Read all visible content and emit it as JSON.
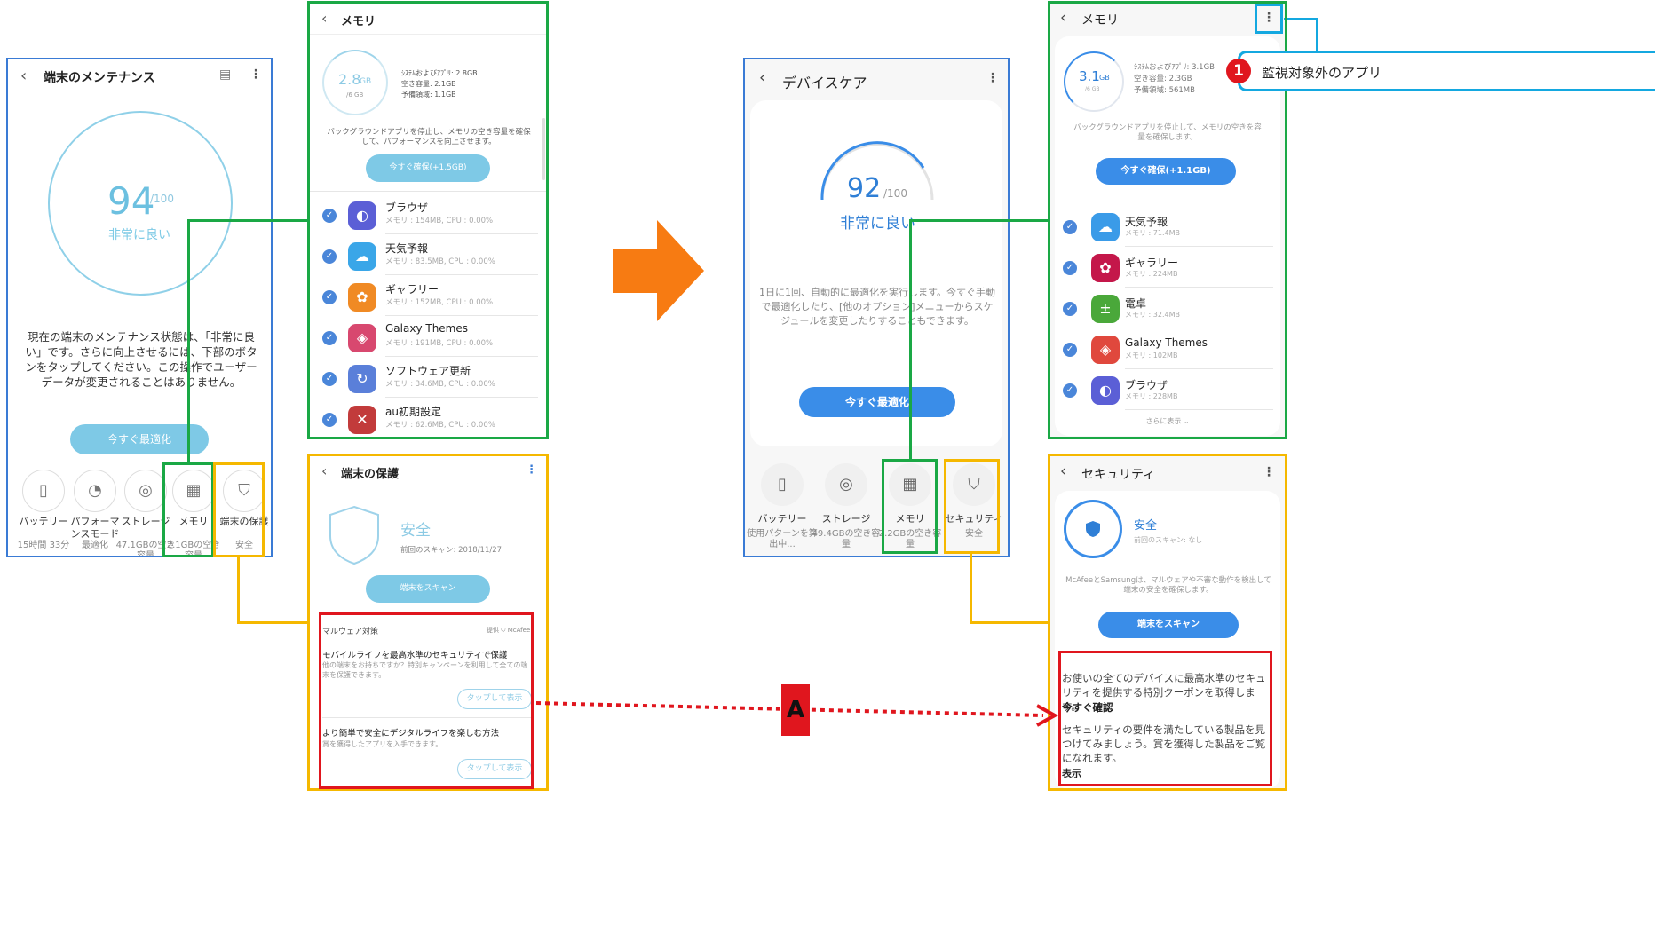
{
  "panel1": {
    "title": "端末のメンテナンス",
    "score": "94",
    "score_max": "/100",
    "status": "非常に良い",
    "desc": "現在の端末のメンテナンス状態は、「非常に良い」です。さらに向上させるには、下部のボタンをタップしてください。この操作でユーザーデータが変更されることはありません。",
    "button": "今すぐ最適化",
    "tiles": [
      {
        "label": "バッテリー",
        "sub": "15時間 33分",
        "icon": "battery-icon"
      },
      {
        "label": "パフォーマンスモード",
        "sub": "最適化",
        "icon": "speedometer-icon"
      },
      {
        "label": "ストレージ",
        "sub": "47.1GBの空き容量",
        "icon": "storage-icon"
      },
      {
        "label": "メモリ",
        "sub": "2.1GBの空き容量",
        "icon": "memory-chip-icon"
      },
      {
        "label": "端末の保護",
        "sub": "安全",
        "icon": "shield-icon"
      }
    ]
  },
  "panel2": {
    "title": "メモリ",
    "gauge_value": "2.8",
    "gauge_unit": "GB",
    "gauge_total": "/6 GB",
    "stat1": "ｼｽﾃﾑおよびｱﾌﾟﾘ: 2.8GB",
    "stat2": "空き容量: 2.1GB",
    "stat3": "予備領域: 1.1GB",
    "desc": "バックグラウンドアプリを停止し、メモリの空き容量を確保して、パフォーマンスを向上させます。",
    "button": "今すぐ確保(+1.5GB)",
    "apps": [
      {
        "name": "ブラウザ",
        "sub": "メモリ : 154MB, CPU : 0.00%"
      },
      {
        "name": "天気予報",
        "sub": "メモリ : 83.5MB, CPU : 0.00%"
      },
      {
        "name": "ギャラリー",
        "sub": "メモリ : 152MB, CPU : 0.00%"
      },
      {
        "name": "Galaxy Themes",
        "sub": "メモリ : 191MB, CPU : 0.00%"
      },
      {
        "name": "ソフトウェア更新",
        "sub": "メモリ : 34.6MB, CPU : 0.00%"
      },
      {
        "name": "au初期設定",
        "sub": "メモリ : 62.6MB, CPU : 0.00%"
      }
    ]
  },
  "panel3": {
    "title": "端末の保護",
    "status": "安全",
    "last_scan": "前回のスキャン: 2018/11/27",
    "button": "端末をスキャン",
    "section": "マルウェア対策",
    "provider": "提供 ⛉ McAfee",
    "card1_title": "モバイルライフを最高水準のセキュリティで保護",
    "card1_text": "他の端末をお持ちですか？特別キャンペーンを利用して全ての端末を保護できます。",
    "card1_button": "タップして表示",
    "card2_title": "より簡単で安全にデジタルライフを楽しむ方法",
    "card2_text": "賞を獲得したアプリを入手できます。",
    "card2_button": "タップして表示"
  },
  "panel4": {
    "title": "デバイスケア",
    "score": "92",
    "score_max": "/100",
    "status": "非常に良い",
    "desc": "1日に1回、自動的に最適化を実行します。今すぐ手動で最適化したり、[他のオプション]メニューからスケジュールを変更したりすることもできます。",
    "button": "今すぐ最適化",
    "tiles": [
      {
        "label": "バッテリー",
        "sub": "使用パターンを算出中...",
        "icon": "battery-icon"
      },
      {
        "label": "ストレージ",
        "sub": "49.4GBの空き容量",
        "icon": "storage-icon"
      },
      {
        "label": "メモリ",
        "sub": "2.2GBの空き容量",
        "icon": "memory-chip-icon"
      },
      {
        "label": "セキュリティ",
        "sub": "安全",
        "icon": "shield-icon"
      }
    ]
  },
  "panel5": {
    "title": "メモリ",
    "gauge_value": "3.1",
    "gauge_unit": "GB",
    "gauge_total": "/6 GB",
    "stat1": "ｼｽﾃﾑおよびｱﾌﾟﾘ: 3.1GB",
    "stat2": "空き容量: 2.3GB",
    "stat3": "予備領域: 561MB",
    "desc": "バックグラウンドアプリを停止して、メモリの空きを容量を確保します。",
    "button": "今すぐ確保(+1.1GB)",
    "apps": [
      {
        "name": "天気予報",
        "sub": "メモリ : 71.4MB"
      },
      {
        "name": "ギャラリー",
        "sub": "メモリ : 224MB"
      },
      {
        "name": "電卓",
        "sub": "メモリ : 32.4MB"
      },
      {
        "name": "Galaxy Themes",
        "sub": "メモリ : 102MB"
      },
      {
        "name": "ブラウザ",
        "sub": "メモリ : 228MB"
      }
    ],
    "more": "さらに表示 ⌄"
  },
  "panel6": {
    "title": "セキュリティ",
    "status": "安全",
    "last_scan": "前回のスキャン: なし",
    "desc": "McAfeeとSamsungは、マルウェアや不審な動作を検出して端末の安全を確保します。",
    "button": "端末をスキャン",
    "card1_text": "お使いの全てのデバイスに最高水準のセキュリティを提供する特別クーポンを取得します。",
    "card1_link": "今すぐ確認",
    "card2_text": "セキュリティの要件を満たしている製品を見つけてみましょう。賞を獲得した製品をご覧になれます。",
    "card2_link": "表示"
  },
  "callout1": {
    "number": "1",
    "label": "監視対象外のアプリ"
  },
  "label_a": "A",
  "colors": {
    "green": "#1aa845",
    "yellow": "#f5b800",
    "red": "#e0161e",
    "cyan": "#14a8e0",
    "orange": "#f77b12",
    "blue_btn": "#3a8de8",
    "light_btn": "#7ec9e6"
  }
}
